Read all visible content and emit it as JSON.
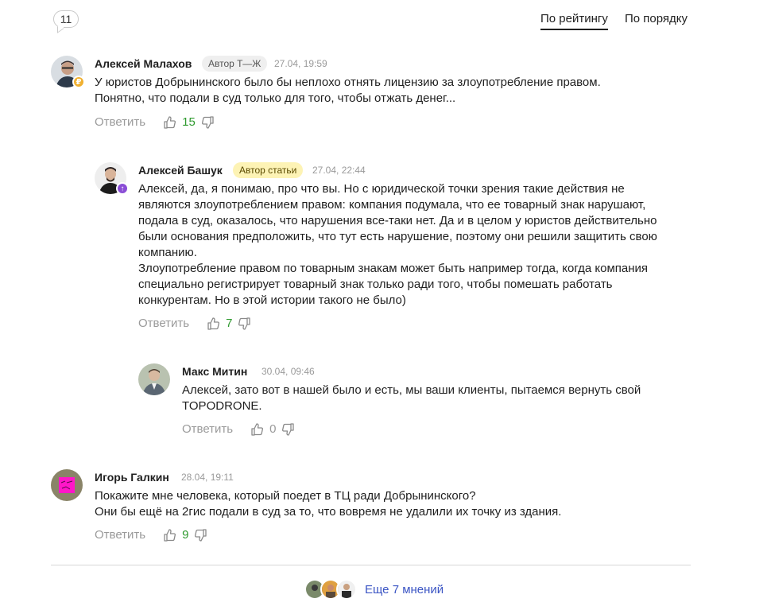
{
  "header": {
    "comment_count": "11",
    "sort_options": [
      "По рейтингу",
      "По порядку"
    ]
  },
  "comments": [
    {
      "author": "Алексей Малахов",
      "tag": "Автор Т—Ж",
      "date": "27.04, 19:59",
      "lines": [
        "У юристов Добрынинского было бы неплохо отнять лицензию за злоупотребление правом.",
        "Понятно, что подали в суд только для того, чтобы отжать денег..."
      ],
      "reply_label": "Ответить",
      "score": "15"
    },
    {
      "author": "Алексей Башук",
      "tag": "Автор статьи",
      "date": "27.04, 22:44",
      "lines": [
        "Алексей, да, я понимаю, про что вы. Но с юридической точки зрения такие действия не",
        "являются злоупотреблением правом: компания подумала, что ее товарный знак нарушают,",
        "подала в суд, оказалось, что нарушения все-таки нет. Да и в целом у юристов действительно",
        "были основания предположить, что тут есть нарушение, поэтому они решили защитить свою",
        "компанию.",
        "Злоупотребление правом по товарным знакам может быть например тогда, когда компания",
        "специально регистрирует товарный знак только ради того, чтобы помешать работать",
        "конкурентам. Но в этой истории такого не было)"
      ],
      "reply_label": "Ответить",
      "score": "7"
    },
    {
      "author": "Макс Митин",
      "date": "30.04, 09:46",
      "lines": [
        "Алексей, зато вот в нашей было и есть, мы ваши клиенты, пытаемся вернуть свой",
        "TOPODRONE."
      ],
      "reply_label": "Ответить",
      "score": "0"
    },
    {
      "author": "Игорь Галкин",
      "date": "28.04, 19:11",
      "lines": [
        "Покажите мне человека, который поедет в ТЦ ради Добрынинского?",
        "Они бы ещё на 2гис подали в суд за то, что вовремя не удалили их точку из здания."
      ],
      "reply_label": "Ответить",
      "score": "9"
    }
  ],
  "footer": {
    "more_label": "Еще 7 мнений"
  },
  "colors": {
    "positive_score": "#2e9a2e",
    "link": "#3b55c4",
    "author_tag_yellow": "#fdf3b5"
  }
}
